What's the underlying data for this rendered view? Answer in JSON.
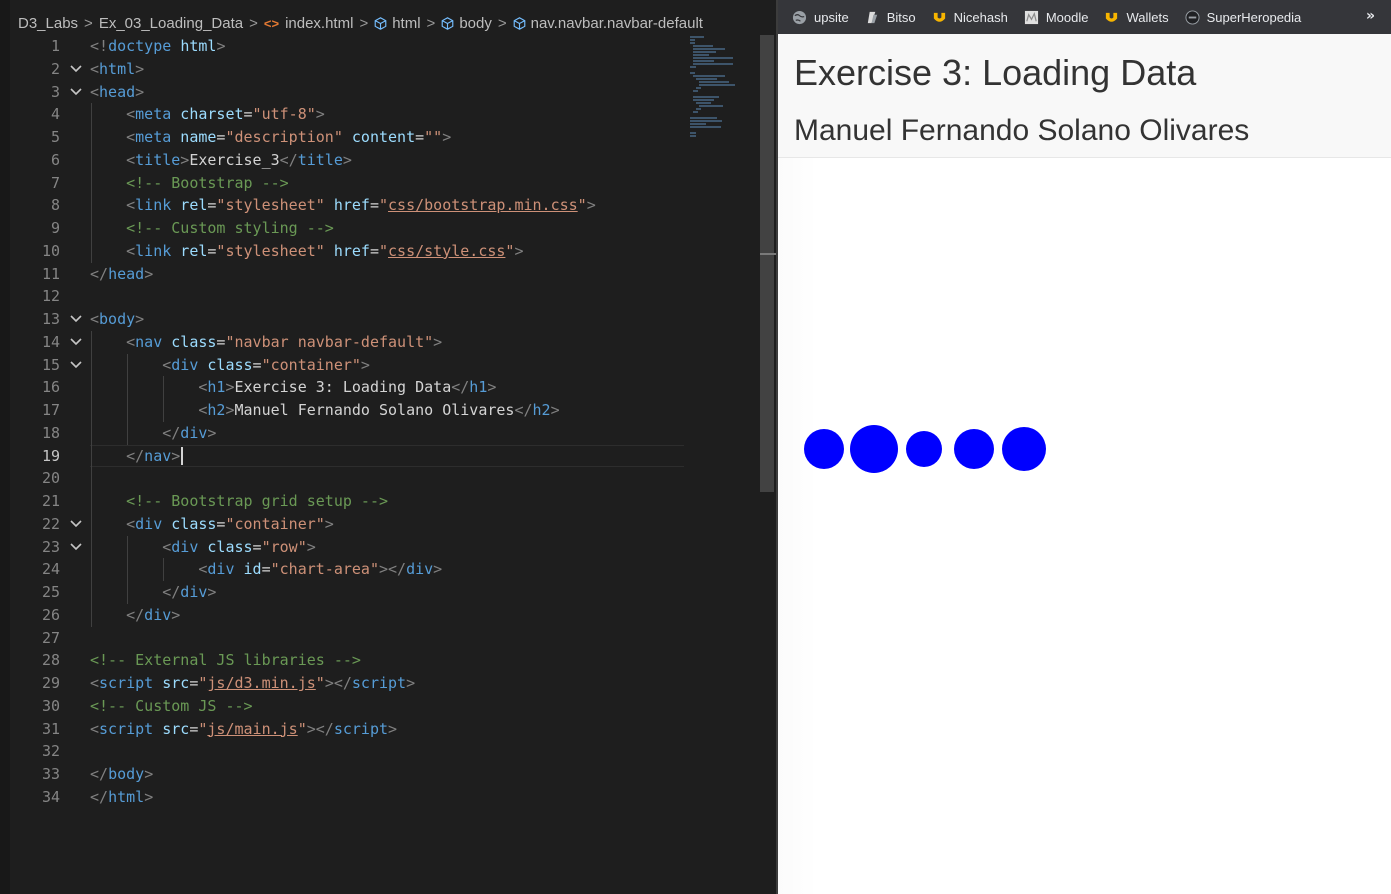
{
  "breadcrumb": [
    {
      "label": "D3_Labs",
      "icon": "none"
    },
    {
      "label": "Ex_03_Loading_Data",
      "icon": "none"
    },
    {
      "label": "index.html",
      "icon": "html-file-icon"
    },
    {
      "label": "html",
      "icon": "cube-icon"
    },
    {
      "label": "body",
      "icon": "cube-icon"
    },
    {
      "label": "nav.navbar.navbar-default",
      "icon": "cube-icon"
    }
  ],
  "breadcrumb_separator": ">",
  "editor": {
    "active_line": 19,
    "lines": [
      {
        "n": "1",
        "fold": false,
        "indent": 0,
        "tokens": [
          [
            "br",
            "<!"
          ],
          [
            "tag",
            "doctype"
          ],
          [
            "txt",
            " "
          ],
          [
            "attr",
            "html"
          ],
          [
            "br",
            ">"
          ]
        ]
      },
      {
        "n": "2",
        "fold": true,
        "indent": 0,
        "tokens": [
          [
            "br",
            "<"
          ],
          [
            "tag",
            "html"
          ],
          [
            "br",
            ">"
          ]
        ]
      },
      {
        "n": "3",
        "fold": true,
        "indent": 0,
        "tokens": [
          [
            "br",
            "<"
          ],
          [
            "tag",
            "head"
          ],
          [
            "br",
            ">"
          ]
        ]
      },
      {
        "n": "4",
        "fold": false,
        "indent": 1,
        "tokens": [
          [
            "br",
            "<"
          ],
          [
            "tag",
            "meta"
          ],
          [
            "txt",
            " "
          ],
          [
            "attr",
            "charset"
          ],
          [
            "txt",
            "="
          ],
          [
            "str",
            "\"utf-8\""
          ],
          [
            "br",
            ">"
          ]
        ]
      },
      {
        "n": "5",
        "fold": false,
        "indent": 1,
        "tokens": [
          [
            "br",
            "<"
          ],
          [
            "tag",
            "meta"
          ],
          [
            "txt",
            " "
          ],
          [
            "attr",
            "name"
          ],
          [
            "txt",
            "="
          ],
          [
            "str",
            "\"description\""
          ],
          [
            "txt",
            " "
          ],
          [
            "attr",
            "content"
          ],
          [
            "txt",
            "="
          ],
          [
            "str",
            "\"\""
          ],
          [
            "br",
            ">"
          ]
        ]
      },
      {
        "n": "6",
        "fold": false,
        "indent": 1,
        "tokens": [
          [
            "br",
            "<"
          ],
          [
            "tag",
            "title"
          ],
          [
            "br",
            ">"
          ],
          [
            "txt",
            "Exercise_3"
          ],
          [
            "br",
            "</"
          ],
          [
            "tag",
            "title"
          ],
          [
            "br",
            ">"
          ]
        ]
      },
      {
        "n": "7",
        "fold": false,
        "indent": 1,
        "tokens": [
          [
            "cm",
            "<!-- Bootstrap -->"
          ]
        ]
      },
      {
        "n": "8",
        "fold": false,
        "indent": 1,
        "tokens": [
          [
            "br",
            "<"
          ],
          [
            "tag",
            "link"
          ],
          [
            "txt",
            " "
          ],
          [
            "attr",
            "rel"
          ],
          [
            "txt",
            "="
          ],
          [
            "str",
            "\"stylesheet\""
          ],
          [
            "txt",
            " "
          ],
          [
            "attr",
            "href"
          ],
          [
            "txt",
            "="
          ],
          [
            "str",
            "\""
          ],
          [
            "link",
            "css/bootstrap.min.css"
          ],
          [
            "str",
            "\""
          ],
          [
            "br",
            ">"
          ]
        ]
      },
      {
        "n": "9",
        "fold": false,
        "indent": 1,
        "tokens": [
          [
            "cm",
            "<!-- Custom styling -->"
          ]
        ]
      },
      {
        "n": "10",
        "fold": false,
        "indent": 1,
        "tokens": [
          [
            "br",
            "<"
          ],
          [
            "tag",
            "link"
          ],
          [
            "txt",
            " "
          ],
          [
            "attr",
            "rel"
          ],
          [
            "txt",
            "="
          ],
          [
            "str",
            "\"stylesheet\""
          ],
          [
            "txt",
            " "
          ],
          [
            "attr",
            "href"
          ],
          [
            "txt",
            "="
          ],
          [
            "str",
            "\""
          ],
          [
            "link",
            "css/style.css"
          ],
          [
            "str",
            "\""
          ],
          [
            "br",
            ">"
          ]
        ]
      },
      {
        "n": "11",
        "fold": false,
        "indent": 0,
        "tokens": [
          [
            "br",
            "</"
          ],
          [
            "tag",
            "head"
          ],
          [
            "br",
            ">"
          ]
        ]
      },
      {
        "n": "12",
        "fold": false,
        "indent": 0,
        "tokens": []
      },
      {
        "n": "13",
        "fold": true,
        "indent": 0,
        "tokens": [
          [
            "br",
            "<"
          ],
          [
            "tag",
            "body"
          ],
          [
            "br",
            ">"
          ]
        ]
      },
      {
        "n": "14",
        "fold": true,
        "indent": 1,
        "tokens": [
          [
            "br",
            "<"
          ],
          [
            "tag",
            "nav"
          ],
          [
            "txt",
            " "
          ],
          [
            "attr",
            "class"
          ],
          [
            "txt",
            "="
          ],
          [
            "str",
            "\"navbar navbar-default\""
          ],
          [
            "br",
            ">"
          ]
        ]
      },
      {
        "n": "15",
        "fold": true,
        "indent": 2,
        "tokens": [
          [
            "br",
            "<"
          ],
          [
            "tag",
            "div"
          ],
          [
            "txt",
            " "
          ],
          [
            "attr",
            "class"
          ],
          [
            "txt",
            "="
          ],
          [
            "str",
            "\"container\""
          ],
          [
            "br",
            ">"
          ]
        ]
      },
      {
        "n": "16",
        "fold": false,
        "indent": 3,
        "tokens": [
          [
            "br",
            "<"
          ],
          [
            "tag",
            "h1"
          ],
          [
            "br",
            ">"
          ],
          [
            "txt",
            "Exercise 3: Loading Data"
          ],
          [
            "br",
            "</"
          ],
          [
            "tag",
            "h1"
          ],
          [
            "br",
            ">"
          ]
        ]
      },
      {
        "n": "17",
        "fold": false,
        "indent": 3,
        "tokens": [
          [
            "br",
            "<"
          ],
          [
            "tag",
            "h2"
          ],
          [
            "br",
            ">"
          ],
          [
            "txt",
            "Manuel Fernando Solano Olivares"
          ],
          [
            "br",
            "</"
          ],
          [
            "tag",
            "h2"
          ],
          [
            "br",
            ">"
          ]
        ]
      },
      {
        "n": "18",
        "fold": false,
        "indent": 2,
        "tokens": [
          [
            "br",
            "</"
          ],
          [
            "tag",
            "div"
          ],
          [
            "br",
            ">"
          ]
        ]
      },
      {
        "n": "19",
        "fold": false,
        "indent": 1,
        "tokens": [
          [
            "br",
            "</"
          ],
          [
            "tag",
            "nav"
          ],
          [
            "br",
            ">"
          ]
        ]
      },
      {
        "n": "20",
        "fold": false,
        "indent": 0,
        "tokens": []
      },
      {
        "n": "21",
        "fold": false,
        "indent": 1,
        "tokens": [
          [
            "cm",
            "<!-- Bootstrap grid setup -->"
          ]
        ]
      },
      {
        "n": "22",
        "fold": true,
        "indent": 1,
        "tokens": [
          [
            "br",
            "<"
          ],
          [
            "tag",
            "div"
          ],
          [
            "txt",
            " "
          ],
          [
            "attr",
            "class"
          ],
          [
            "txt",
            "="
          ],
          [
            "str",
            "\"container\""
          ],
          [
            "br",
            ">"
          ]
        ]
      },
      {
        "n": "23",
        "fold": true,
        "indent": 2,
        "tokens": [
          [
            "br",
            "<"
          ],
          [
            "tag",
            "div"
          ],
          [
            "txt",
            " "
          ],
          [
            "attr",
            "class"
          ],
          [
            "txt",
            "="
          ],
          [
            "str",
            "\"row\""
          ],
          [
            "br",
            ">"
          ]
        ]
      },
      {
        "n": "24",
        "fold": false,
        "indent": 3,
        "tokens": [
          [
            "br",
            "<"
          ],
          [
            "tag",
            "div"
          ],
          [
            "txt",
            " "
          ],
          [
            "attr",
            "id"
          ],
          [
            "txt",
            "="
          ],
          [
            "str",
            "\"chart-area\""
          ],
          [
            "br",
            "></"
          ],
          [
            "tag",
            "div"
          ],
          [
            "br",
            ">"
          ]
        ]
      },
      {
        "n": "25",
        "fold": false,
        "indent": 2,
        "tokens": [
          [
            "br",
            "</"
          ],
          [
            "tag",
            "div"
          ],
          [
            "br",
            ">"
          ]
        ]
      },
      {
        "n": "26",
        "fold": false,
        "indent": 1,
        "tokens": [
          [
            "br",
            "</"
          ],
          [
            "tag",
            "div"
          ],
          [
            "br",
            ">"
          ]
        ]
      },
      {
        "n": "27",
        "fold": false,
        "indent": 0,
        "tokens": []
      },
      {
        "n": "28",
        "fold": false,
        "indent": 0,
        "tokens": [
          [
            "cm",
            "<!-- External JS libraries -->"
          ]
        ]
      },
      {
        "n": "29",
        "fold": false,
        "indent": 0,
        "tokens": [
          [
            "br",
            "<"
          ],
          [
            "tag",
            "script"
          ],
          [
            "txt",
            " "
          ],
          [
            "attr",
            "src"
          ],
          [
            "txt",
            "="
          ],
          [
            "str",
            "\""
          ],
          [
            "link",
            "js/d3.min.js"
          ],
          [
            "str",
            "\""
          ],
          [
            "br",
            "></"
          ],
          [
            "tag",
            "script"
          ],
          [
            "br",
            ">"
          ]
        ]
      },
      {
        "n": "30",
        "fold": false,
        "indent": 0,
        "tokens": [
          [
            "cm",
            "<!-- Custom JS -->"
          ]
        ]
      },
      {
        "n": "31",
        "fold": false,
        "indent": 0,
        "tokens": [
          [
            "br",
            "<"
          ],
          [
            "tag",
            "script"
          ],
          [
            "txt",
            " "
          ],
          [
            "attr",
            "src"
          ],
          [
            "txt",
            "="
          ],
          [
            "str",
            "\""
          ],
          [
            "link",
            "js/main.js"
          ],
          [
            "str",
            "\""
          ],
          [
            "br",
            "></"
          ],
          [
            "tag",
            "script"
          ],
          [
            "br",
            ">"
          ]
        ]
      },
      {
        "n": "32",
        "fold": false,
        "indent": 0,
        "tokens": []
      },
      {
        "n": "33",
        "fold": false,
        "indent": 0,
        "tokens": [
          [
            "br",
            "</"
          ],
          [
            "tag",
            "body"
          ],
          [
            "br",
            ">"
          ]
        ]
      },
      {
        "n": "34",
        "fold": false,
        "indent": 0,
        "tokens": [
          [
            "br",
            "</"
          ],
          [
            "tag",
            "html"
          ],
          [
            "br",
            ">"
          ]
        ]
      }
    ]
  },
  "bookmarks": [
    {
      "label": "upsite",
      "icon": "globe-icon"
    },
    {
      "label": "Bitso",
      "icon": "bitso-icon"
    },
    {
      "label": "Nicehash",
      "icon": "nicehash-icon"
    },
    {
      "label": "Moodle",
      "icon": "moodle-icon"
    },
    {
      "label": "Wallets",
      "icon": "nicehash-icon"
    },
    {
      "label": "SuperHeropedia",
      "icon": "superhero-icon"
    }
  ],
  "bookmarks_overflow": "»",
  "page": {
    "h1": "Exercise 3: Loading Data",
    "h2": "Manuel Fernando Solano Olivares"
  },
  "colors": {
    "circle_fill": "#0000ff",
    "navbar_bg": "#f8f8f8",
    "bookmark_bar_bg": "#35363a",
    "editor_bg": "#1e1e1e"
  },
  "chart_data": {
    "type": "scatter",
    "circles": [
      {
        "index": 0,
        "radius": 20
      },
      {
        "index": 1,
        "radius": 24
      },
      {
        "index": 2,
        "radius": 18
      },
      {
        "index": 3,
        "radius": 20
      },
      {
        "index": 4,
        "radius": 22
      }
    ]
  }
}
